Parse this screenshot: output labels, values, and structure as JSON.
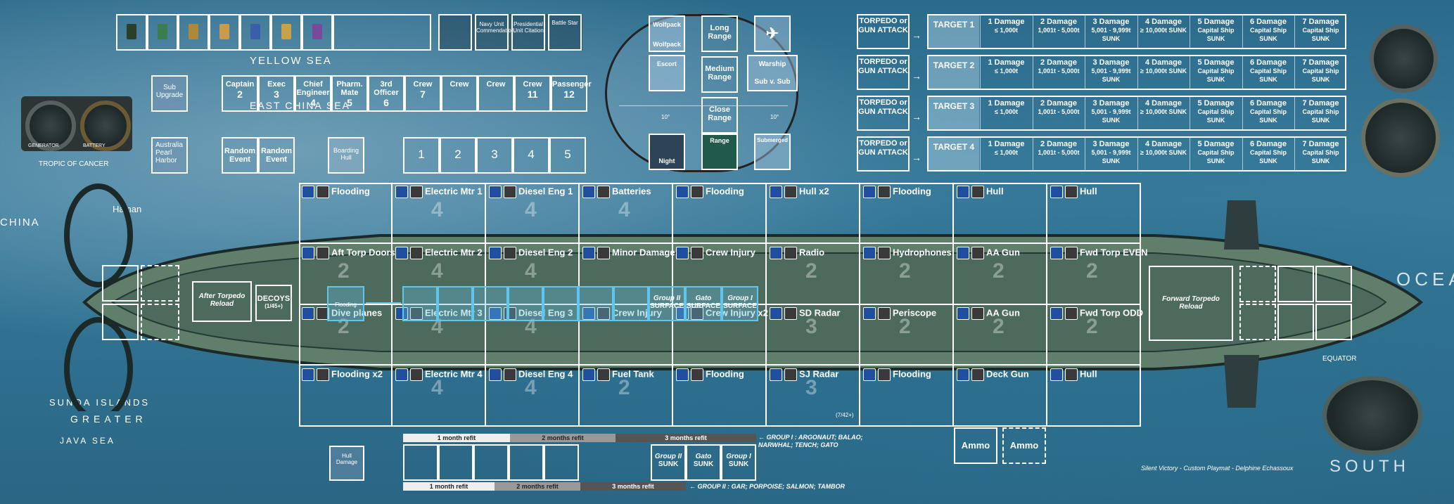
{
  "map_labels": {
    "yellow_sea": "YELLOW SEA",
    "east_china_sea": "EAST CHINA SEA",
    "china": "CHINA",
    "hainan": "Hainan",
    "tropic": "TROPIC OF CANCER",
    "sunda": "SUNDA ISLANDS",
    "greater": "GREATER",
    "java_sea": "JAVA SEA",
    "ocean": "OCEAN",
    "south": "SOUTH",
    "equator": "EQUATOR"
  },
  "medals": {
    "count": 7
  },
  "awards": [
    "Navy Unit Commendation",
    "Presidential Unit Citation",
    "Battle Star"
  ],
  "sub_upgrade": "Sub Upgrade",
  "base": {
    "line1": "Australia",
    "line2": "Pearl",
    "line3": "Harbor"
  },
  "crew": [
    "Captain",
    "Exec",
    "Chief Engineer",
    "Pharm. Mate",
    "3rd Officer",
    "Crew",
    "Crew",
    "Crew",
    "Crew",
    "Passenger"
  ],
  "crew_nums": [
    "2",
    "3",
    "4",
    "5",
    "6",
    "7",
    "",
    "",
    "11",
    "12"
  ],
  "random_event": "Random Event",
  "boarding": "Boarding Hull",
  "numbered": [
    "1",
    "2",
    "3",
    "4",
    "5"
  ],
  "ranges": {
    "wolfpack": "Wolfpack",
    "escort": "Escort",
    "long": "Long Range",
    "medium": "Medium Range",
    "close": "Close Range",
    "warship": "Warship",
    "sub_v_sub": "Sub v. Sub",
    "night": "Night",
    "range": "Range",
    "submerged": "Submerged",
    "deg1": "10°",
    "deg2": "10°"
  },
  "attack_label": "TORPEDO or GUN ATTACK",
  "targets": [
    "TARGET 1",
    "TARGET 2",
    "TARGET 3",
    "TARGET 4"
  ],
  "damage_cols": [
    {
      "t": "1 Damage",
      "s": "≤ 1,000t"
    },
    {
      "t": "2 Damage",
      "s": "1,001t - 5,000t"
    },
    {
      "t": "3 Damage",
      "s": "5,001 - 9,999t SUNK"
    },
    {
      "t": "4 Damage",
      "s": "≥ 10,000t SUNK"
    },
    {
      "t": "5 Damage",
      "s": "Capital Ship SUNK"
    },
    {
      "t": "6 Damage",
      "s": "Capital Ship SUNK"
    },
    {
      "t": "7 Damage",
      "s": "Capital Ship SUNK"
    }
  ],
  "row1": [
    "Flooding",
    "Electric Mtr 1",
    "Diesel Eng 1",
    "Batteries",
    "Flooding",
    "Hull x2",
    "Flooding",
    "Hull",
    "Hull"
  ],
  "row2": [
    "Aft Torp Doors",
    "Electric Mtr 2",
    "Diesel Eng 2",
    "Minor Damage",
    "Crew Injury",
    "Radio",
    "Hydrophones",
    "AA Gun",
    "Fwd Torp EVEN"
  ],
  "row3": [
    "Dive planes",
    "Electric Mtr 3",
    "Diesel Eng 3",
    "Crew Injury",
    "Crew Injury x2",
    "SD Radar",
    "Periscope",
    "AA Gun",
    "Fwd Torp ODD"
  ],
  "row4": [
    "Flooding x2",
    "Electric Mtr 4",
    "Diesel Eng 4",
    "Fuel Tank",
    "Flooding",
    "SJ Radar",
    "Flooding",
    "Deck Gun",
    "Hull"
  ],
  "sj_note": "(7/42+)",
  "big_nums": {
    "r1": [
      "",
      "4",
      "4",
      "4",
      "",
      "",
      "",
      "",
      ""
    ],
    "r2": [
      "2",
      "4",
      "4",
      "",
      "",
      "2",
      "2",
      "2",
      "2"
    ],
    "r3": [
      "2",
      "4",
      "4",
      "",
      "",
      "3",
      "2",
      "2",
      "2"
    ],
    "r4": [
      "",
      "4",
      "4",
      "2",
      "",
      "3",
      "",
      "",
      ""
    ]
  },
  "aft_reload": "After Torpedo Reload",
  "decoys": "DECOYS",
  "decoys_sub": "(1/45+)",
  "flooding_token": "Flooding",
  "surface_track": [
    {
      "a": "Group II",
      "b": "SURFACE"
    },
    {
      "a": "Gato",
      "b": "SURFACE"
    },
    {
      "a": "Group I",
      "b": "SURFACE"
    }
  ],
  "sunk_track": [
    {
      "a": "Group II",
      "b": "SUNK"
    },
    {
      "a": "Gato",
      "b": "SUNK"
    },
    {
      "a": "Group I",
      "b": "SUNK"
    }
  ],
  "fwd_reload": "Forward Torpedo Reload",
  "ammo": [
    "Ammo",
    "Ammo"
  ],
  "hull_damage": "Hull Damage",
  "refit": [
    "1 month refit",
    "2 months refit",
    "3 months refit"
  ],
  "group1_note": "← GROUP I : ARGONAUT; BALAO; NARWHAL; TENCH; GATO",
  "group2_note": "← GROUP II : GAR; PORPOISE; SALMON; TAMBOR",
  "credit": "Silent Victory - Custom Playmat - Delphine Echassoux",
  "gauges": [
    "GENERATOR",
    "BATTERY"
  ]
}
